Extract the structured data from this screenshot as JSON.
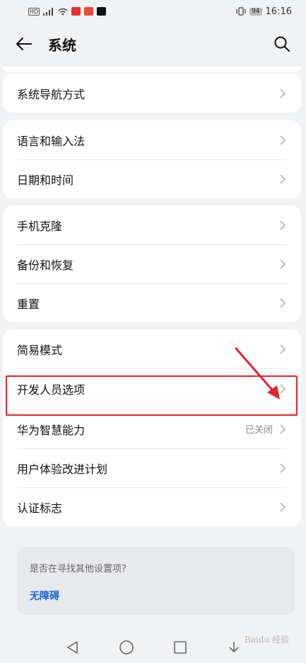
{
  "status_bar": {
    "time": "16:16",
    "battery": "94",
    "network_badge": "HD"
  },
  "app_bar": {
    "title": "系统"
  },
  "sections": [
    {
      "items": [
        {
          "label": "系统导航方式"
        }
      ]
    },
    {
      "items": [
        {
          "label": "语言和输入法"
        },
        {
          "label": "日期和时间"
        }
      ]
    },
    {
      "items": [
        {
          "label": "手机克隆"
        },
        {
          "label": "备份和恢复"
        },
        {
          "label": "重置"
        }
      ]
    },
    {
      "items": [
        {
          "label": "简易模式"
        },
        {
          "label": "开发人员选项"
        },
        {
          "label": "华为智慧能力",
          "value": "已关闭"
        },
        {
          "label": "用户体验改进计划"
        },
        {
          "label": "认证标志"
        }
      ]
    }
  ],
  "suggestion": {
    "title": "是否在寻找其他设置项?",
    "link": "无障碍"
  },
  "colors": {
    "highlight": "#e5252a",
    "link": "#1c63d8"
  },
  "watermark": "Baidu 经验"
}
